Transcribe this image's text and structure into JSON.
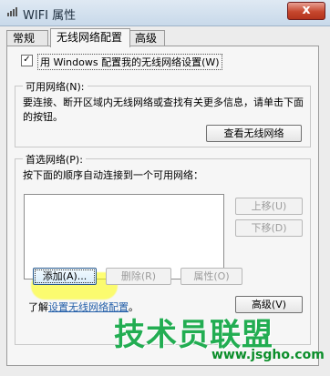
{
  "window": {
    "title": "WIFI 属性",
    "close_label": "x"
  },
  "tabs": [
    {
      "label": "常规"
    },
    {
      "label": "无线网络配置"
    },
    {
      "label": "高级"
    }
  ],
  "wireless": {
    "use_windows_checkbox": {
      "checked": true,
      "label": "用 Windows 配置我的无线网络设置(W)"
    },
    "available_networks": {
      "title": "可用网络(N):",
      "description": "要连接、断开区域内无线网络或查找有关更多信息，请单击下面的按钮。",
      "view_button": "查看无线网络"
    },
    "preferred_networks": {
      "title": "首选网络(P):",
      "description": "按下面的顺序自动连接到一个可用网络：",
      "move_up_button": "上移(U)",
      "move_down_button": "下移(D)",
      "add_button": "添加(A)...",
      "remove_button": "删除(R)",
      "properties_button": "属性(O)"
    },
    "learn_prefix": "了解",
    "learn_link": "设置无线网络配置",
    "learn_suffix": "。",
    "advanced_button": "高级(V)"
  },
  "watermark": {
    "text": "技术员联盟",
    "url": "www.jsgho.com"
  },
  "colors": {
    "watermark_green": "#22ad52",
    "link_blue": "#225ea8"
  }
}
